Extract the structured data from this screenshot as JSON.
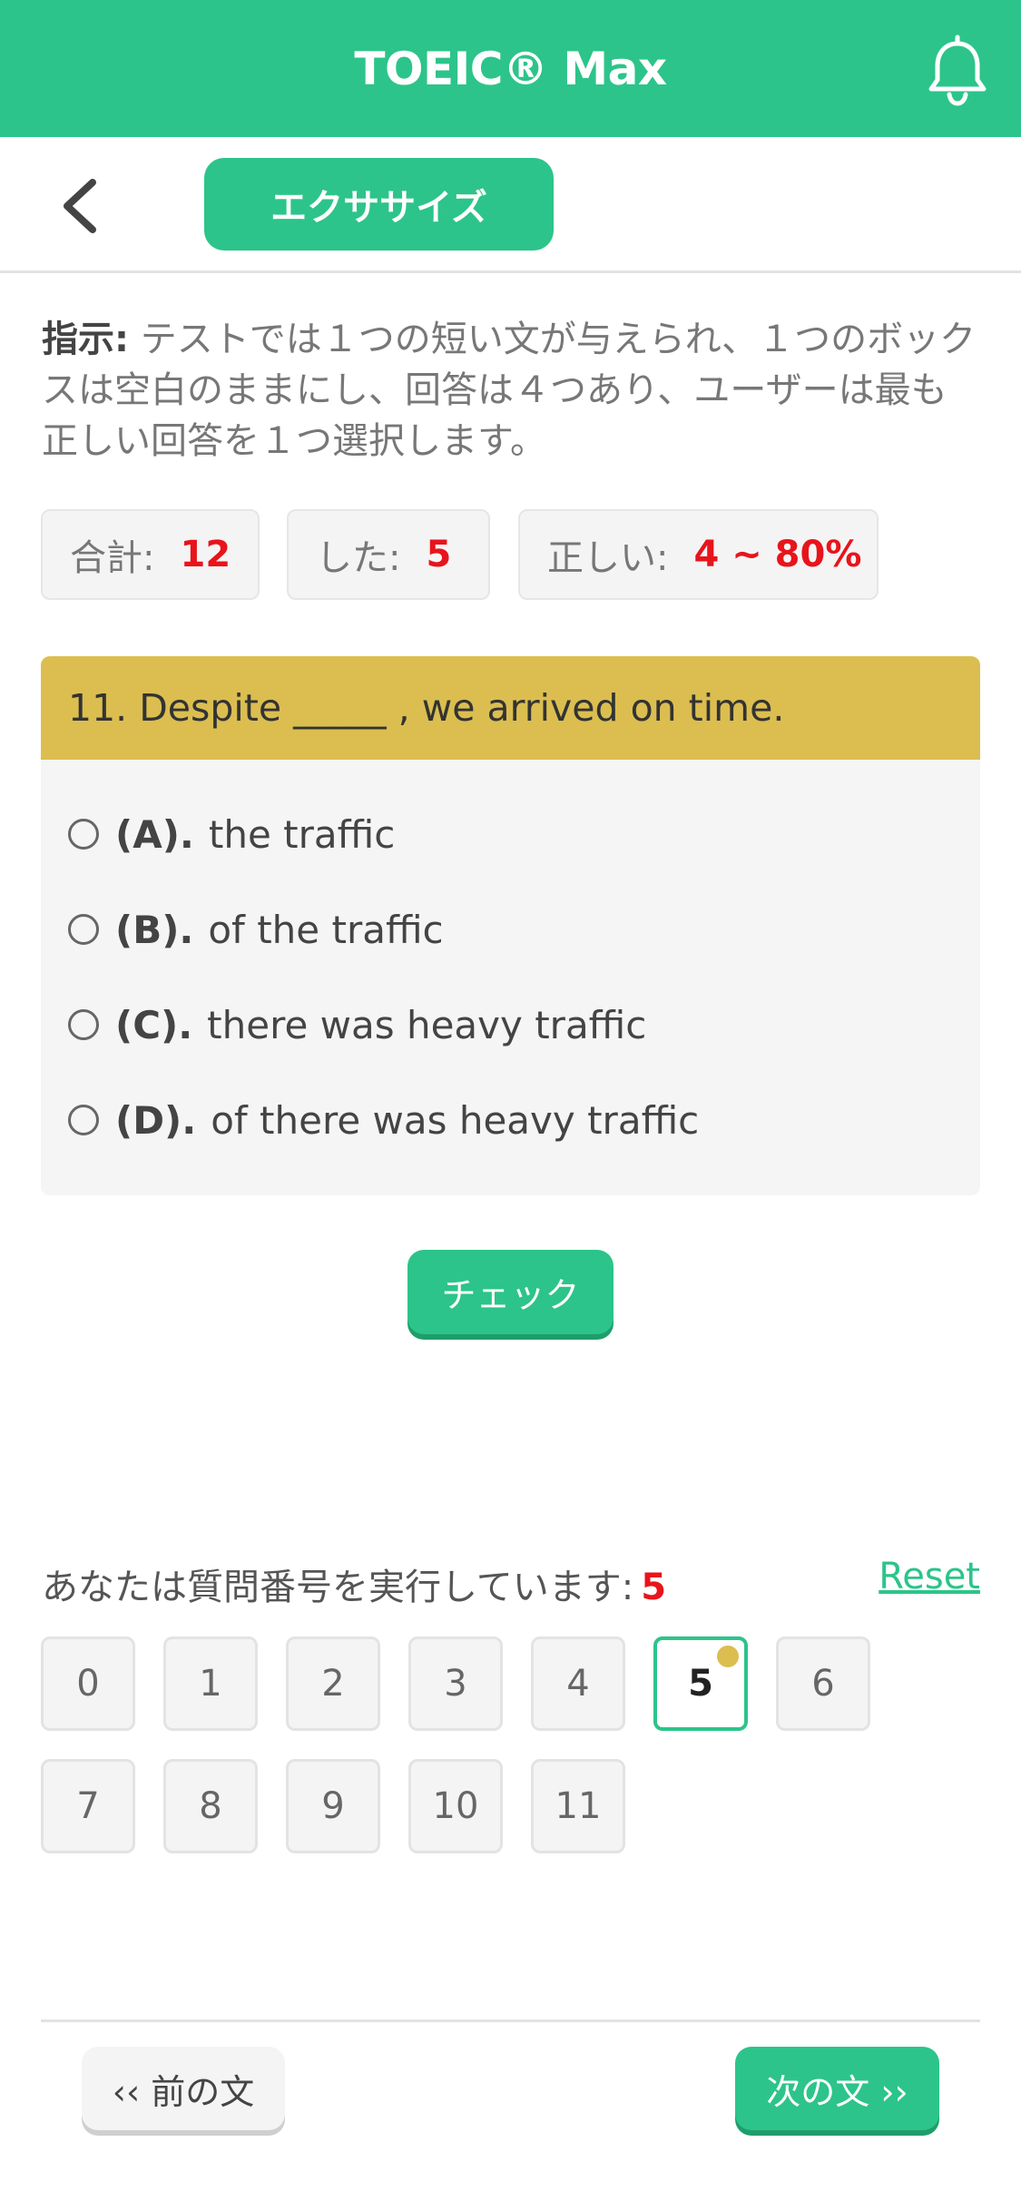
{
  "header": {
    "title": "TOEIC® Max",
    "icon": "bell-icon"
  },
  "subbar": {
    "back_icon": "chevron-left-icon",
    "tab_label": "エクササイズ"
  },
  "instructions": {
    "label": "指示:",
    "text": " テストでは１つの短い文が与えられ、１つのボックスは空白のままにし、回答は４つあり、ユーザーは最も正しい回答を１つ選択します。"
  },
  "stats": [
    {
      "label": "合計:",
      "value": "12"
    },
    {
      "label": "した:",
      "value": "5"
    },
    {
      "label": "正しい:",
      "value": "4 ~ 80%"
    }
  ],
  "question": {
    "text": "11. Despite _____ , we arrived on time.",
    "options": [
      {
        "key": "(A).",
        "text": "the traffic"
      },
      {
        "key": "(B).",
        "text": "of the traffic"
      },
      {
        "key": "(C).",
        "text": "there was heavy traffic"
      },
      {
        "key": "(D).",
        "text": "of there was heavy traffic"
      }
    ]
  },
  "check_label": "チェック",
  "progress": {
    "label": "あなたは質問番号を実行しています:",
    "current": "5",
    "reset_label": "Reset",
    "numbers": [
      "0",
      "1",
      "2",
      "3",
      "4",
      "5",
      "6",
      "7",
      "8",
      "9",
      "10",
      "11"
    ]
  },
  "nav": {
    "prev_label": "‹‹ 前の文",
    "next_label": "次の文 ››"
  },
  "colors": {
    "accent": "#2cc48a",
    "question_header": "#dbbe4f",
    "highlight": "#e8141b"
  }
}
